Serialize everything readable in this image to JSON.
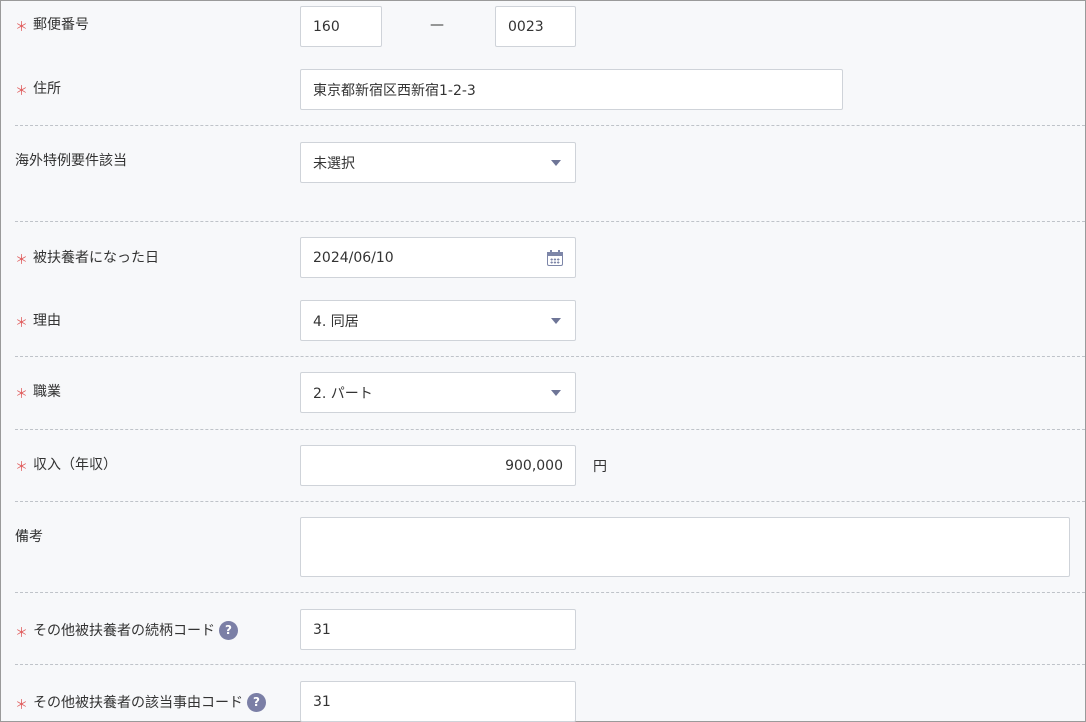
{
  "postal": {
    "label": "郵便番号",
    "part1": "160",
    "separator": "—",
    "part2": "0023"
  },
  "address": {
    "label": "住所",
    "value": "東京都新宿区西新宿1-2-3"
  },
  "overseas": {
    "label": "海外特例要件該当",
    "value": "未選択"
  },
  "dependent_date": {
    "label": "被扶養者になった日",
    "value": "2024/06/10",
    "icon": "calendar-icon"
  },
  "reason": {
    "label": "理由",
    "value": "4. 同居"
  },
  "occupation": {
    "label": "職業",
    "value": "2. パート"
  },
  "income": {
    "label": "収入（年収）",
    "value": "900,000",
    "unit": "円"
  },
  "remarks": {
    "label": "備考",
    "value": ""
  },
  "relation_code": {
    "label": "その他被扶養者の続柄コード",
    "value": "31",
    "help": "?"
  },
  "reason_code": {
    "label": "その他被扶養者の該当事由コード",
    "value": "31",
    "help": "?"
  },
  "required_mark": "＊",
  "colors": {
    "required": "#e05c5c",
    "help_badge": "#7b7fa6",
    "caret": "#6e7597"
  }
}
